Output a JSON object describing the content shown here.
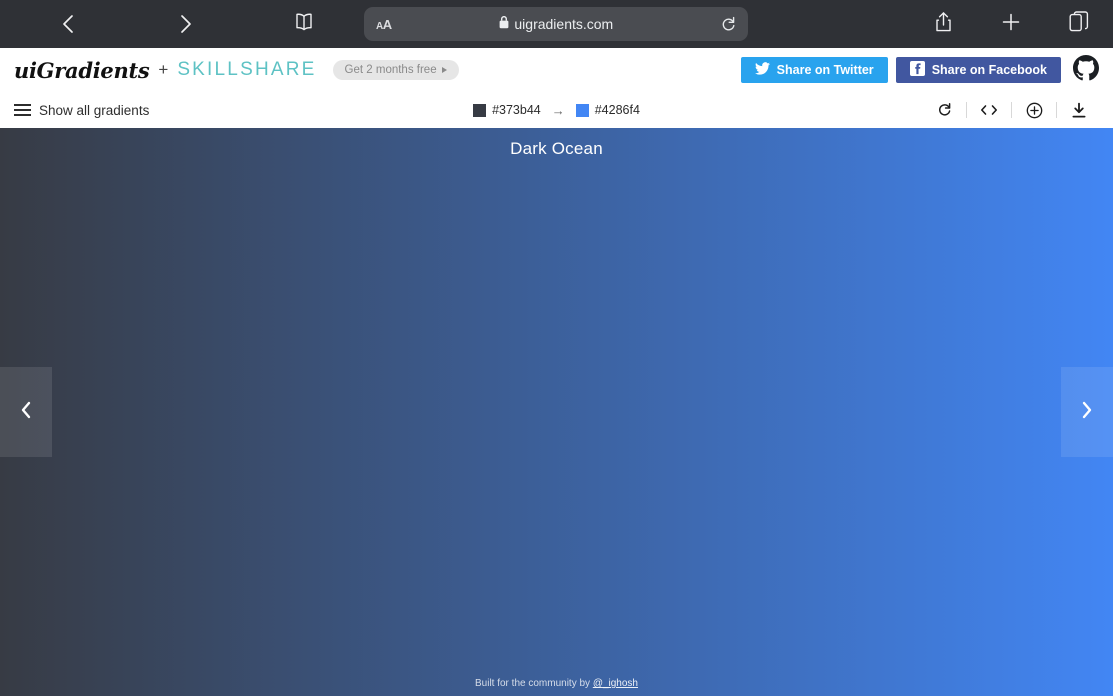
{
  "browser": {
    "back_icon": "chevron-left-icon",
    "forward_icon": "chevron-right-icon",
    "bookmarks_icon": "book-icon",
    "text_size_label": "AA",
    "lock_icon": "lock-icon",
    "url": "uigradients.com",
    "reload_icon": "reload-icon",
    "share_icon": "share-icon",
    "new_tab_icon": "plus-icon",
    "tabs_icon": "tabs-icon"
  },
  "header": {
    "brand": "uiGradients",
    "separator": "+",
    "partner": "SKILLSHARE",
    "promo_label": "Get 2 months free",
    "twitter_label": "Share on Twitter",
    "facebook_label": "Share on Facebook",
    "github_icon": "github-icon",
    "twitter_color": "#29a3ee",
    "facebook_color": "#4157a0",
    "partner_color": "#5ec2c4"
  },
  "subbar": {
    "show_all_label": "Show all gradients",
    "menu_icon": "hamburger-icon",
    "color_start": "#373b44",
    "color_end": "#4286f4",
    "arrow": "→",
    "tools": [
      {
        "name": "randomize-icon",
        "label": "randomize"
      },
      {
        "name": "code-icon",
        "label": "code"
      },
      {
        "name": "add-icon",
        "label": "add"
      },
      {
        "name": "download-icon",
        "label": "download"
      }
    ]
  },
  "gradient": {
    "title": "Dark Ocean",
    "from": "#373b44",
    "to": "#4286f4",
    "angle": "90deg",
    "prev_icon": "chevron-left-icon",
    "next_icon": "chevron-right-icon"
  },
  "footer": {
    "credit_prefix": "Built for the community by ",
    "credit_handle": "@_ighosh"
  }
}
